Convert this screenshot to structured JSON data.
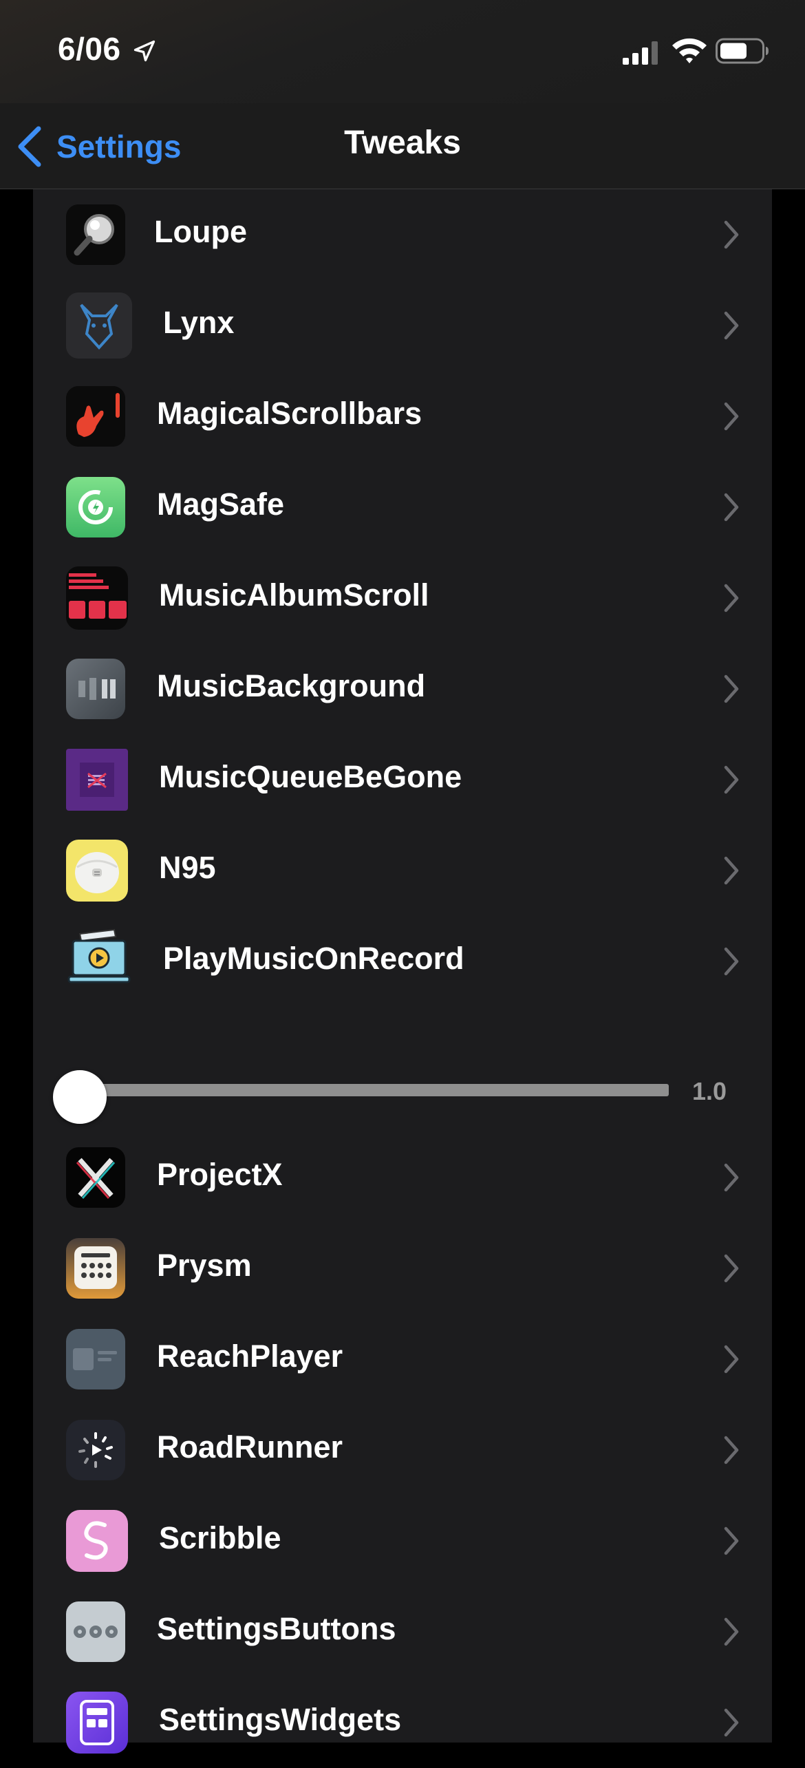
{
  "status_bar": {
    "time": "6/06"
  },
  "nav": {
    "back_label": "Settings",
    "title": "Tweaks"
  },
  "rows_top": [
    {
      "label": "Loupe",
      "icon": "loupe-icon"
    },
    {
      "label": "Lynx",
      "icon": "lynx-icon"
    },
    {
      "label": "MagicalScrollbars",
      "icon": "magical-scrollbars-icon"
    },
    {
      "label": "MagSafe",
      "icon": "magsafe-icon"
    },
    {
      "label": "MusicAlbumScroll",
      "icon": "music-album-scroll-icon"
    },
    {
      "label": "MusicBackground",
      "icon": "music-background-icon"
    },
    {
      "label": "MusicQueueBeGone",
      "icon": "music-queue-be-gone-icon"
    },
    {
      "label": "N95",
      "icon": "n95-mask-icon"
    },
    {
      "label": "PlayMusicOnRecord",
      "icon": "play-music-on-record-icon"
    }
  ],
  "slider": {
    "value_label": "1.0",
    "fill_fraction": 0.0
  },
  "rows_bottom": [
    {
      "label": "ProjectX",
      "icon": "projectx-icon"
    },
    {
      "label": "Prysm",
      "icon": "prysm-icon"
    },
    {
      "label": "ReachPlayer",
      "icon": "reachplayer-icon"
    },
    {
      "label": "RoadRunner",
      "icon": "roadrunner-icon"
    },
    {
      "label": "Scribble",
      "icon": "scribble-icon"
    },
    {
      "label": "SettingsButtons",
      "icon": "settings-buttons-icon"
    },
    {
      "label": "SettingsWidgets",
      "icon": "settings-widgets-icon"
    }
  ],
  "colors": {
    "accent": "#3d8ef5",
    "panel": "#1c1c1e",
    "background": "#000000"
  }
}
